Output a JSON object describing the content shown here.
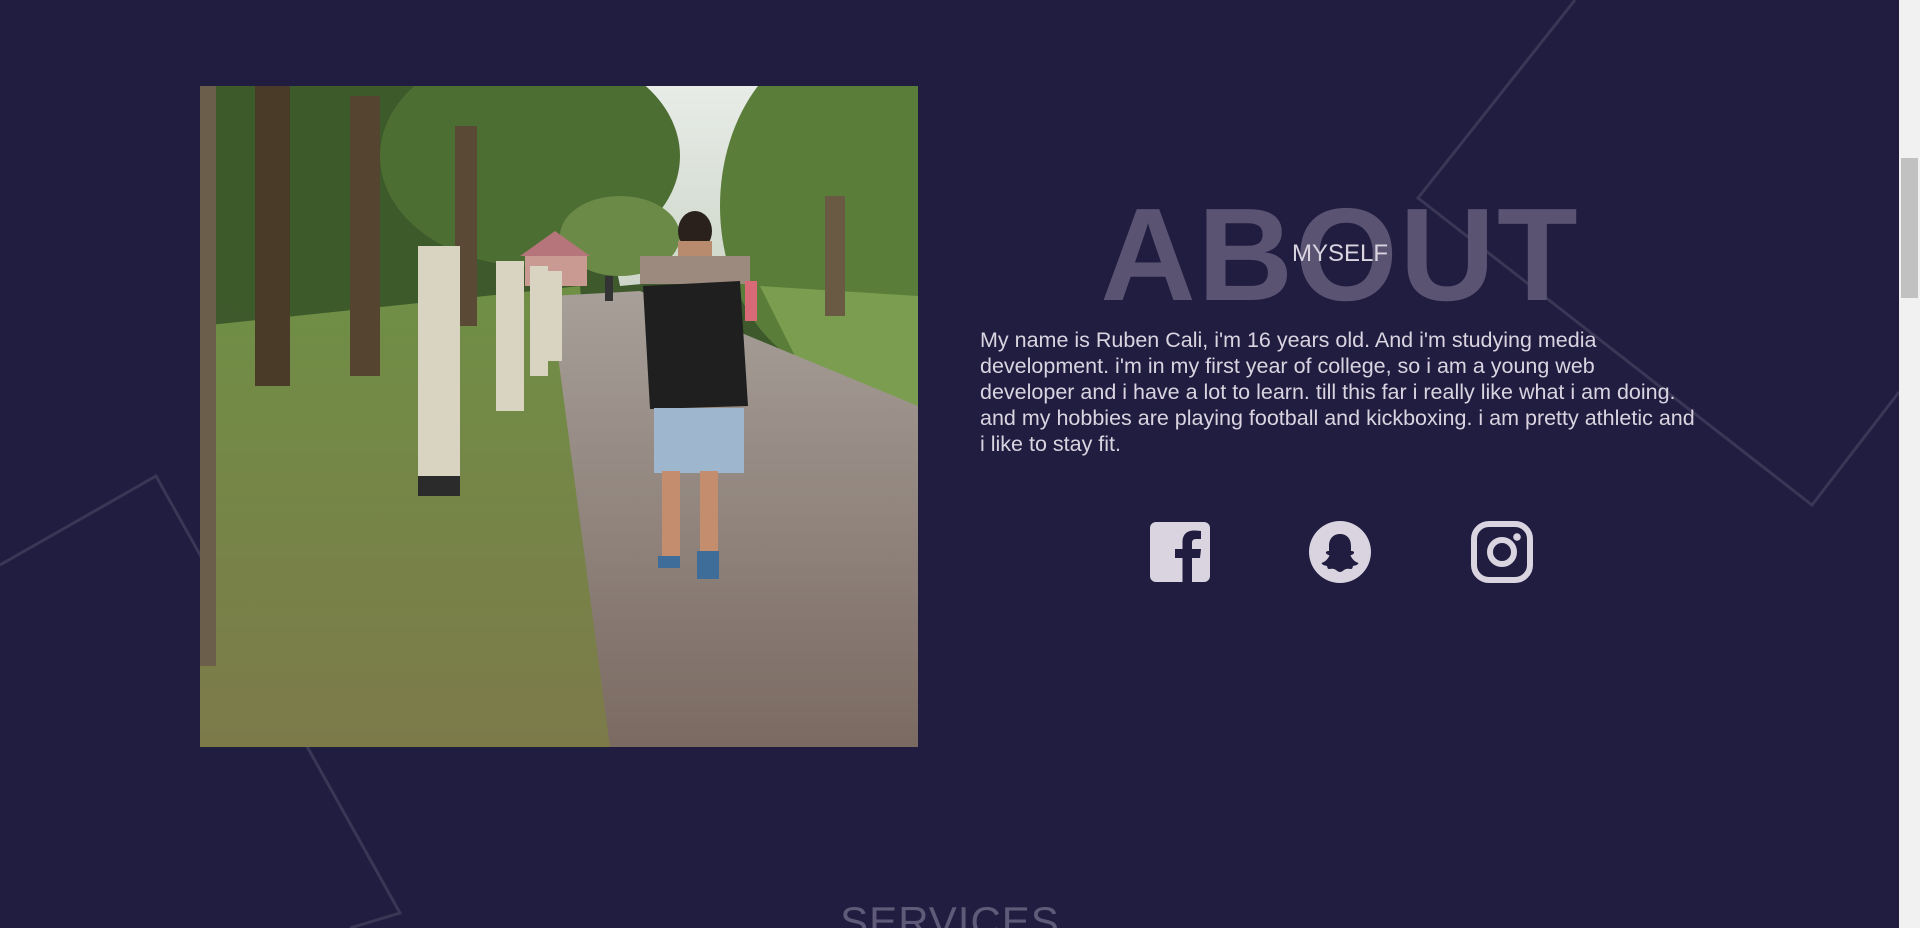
{
  "about": {
    "heading_big": "ABOUT",
    "heading_small": "MYSELF",
    "bio": "My name is Ruben Cali, i'm 16 years old. And i'm studying media development. i'm in my first year of college, so i am a young web developer and i have a lot to learn. till this far i really like what i am doing. and my hobbies are playing football and kickboxing. i am pretty athletic and i like to stay fit."
  },
  "socials": [
    {
      "name": "facebook",
      "icon": "facebook-icon"
    },
    {
      "name": "snapchat",
      "icon": "snapchat-icon"
    },
    {
      "name": "instagram",
      "icon": "instagram-icon"
    }
  ],
  "next_section": {
    "title": "SERVICES"
  },
  "colors": {
    "background": "#211d40",
    "text": "#d9d4e0",
    "heading_watermark": "#5a5372",
    "icon": "#d9d4e0"
  }
}
